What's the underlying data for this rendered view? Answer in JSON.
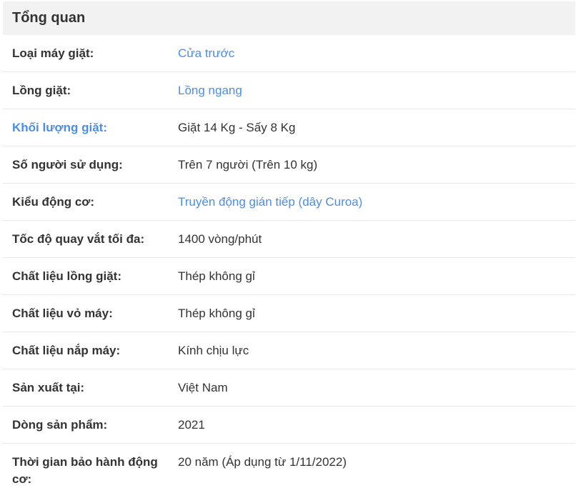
{
  "section_title": "Tổng quan",
  "rows": [
    {
      "label": "Loại máy giặt:",
      "value": "Cửa trước"
    },
    {
      "label": "Lồng giặt:",
      "value": "Lồng ngang"
    },
    {
      "label": "Khối lượng giặt:",
      "value": "Giặt 14 Kg - Sấy 8 Kg"
    },
    {
      "label": "Số người sử dụng:",
      "value": "Trên 7 người (Trên 10 kg)"
    },
    {
      "label": "Kiểu động cơ:",
      "value": "Truyền động gián tiếp (dây Curoa)"
    },
    {
      "label": "Tốc độ quay vắt tối đa:",
      "value": "1400 vòng/phút"
    },
    {
      "label": "Chất liệu lồng giặt:",
      "value": "Thép không gỉ"
    },
    {
      "label": "Chất liệu vỏ máy:",
      "value": "Thép không gỉ"
    },
    {
      "label": "Chất liệu nắp máy:",
      "value": "Kính chịu lực"
    },
    {
      "label": "Sản xuất tại:",
      "value": "Việt Nam"
    },
    {
      "label": "Dòng sản phẩm:",
      "value": "2021"
    },
    {
      "label": "Thời gian bảo hành động cơ:",
      "value": "20 năm (Áp dụng từ 1/11/2022)"
    }
  ],
  "colors": {
    "link": "#4a8ee6",
    "text": "#333333",
    "header_bg": "#f2f2f2"
  }
}
